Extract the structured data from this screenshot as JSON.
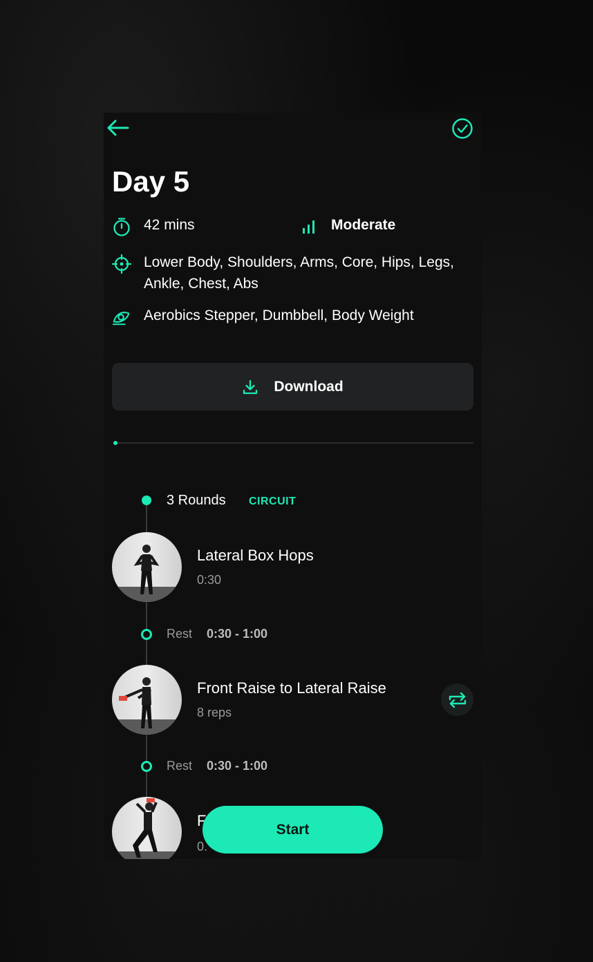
{
  "workout": {
    "title": "Day 5",
    "duration": "42 mins",
    "level": "Moderate",
    "target_areas": "Lower Body, Shoulders, Arms, Core, Hips, Legs, Ankle, Chest, Abs",
    "equipment": "Aerobics Stepper, Dumbbell, Body Weight"
  },
  "download_label": "Download",
  "circuit": {
    "rounds_label": "3 Rounds",
    "type_tag": "CIRCUIT"
  },
  "exercises": [
    {
      "name": "Lateral Box Hops",
      "detail": "0:30"
    },
    {
      "name": "Front Raise to Lateral Raise",
      "detail": "8 reps"
    },
    {
      "name": "F",
      "detail": "0."
    }
  ],
  "rests": [
    {
      "label": "Rest",
      "value": "0:30 - 1:00"
    },
    {
      "label": "Rest",
      "value": "0:30 - 1:00"
    }
  ],
  "start_label": "Start",
  "icons": {
    "back": "arrow-left-icon",
    "complete": "check-circle-icon",
    "duration": "stopwatch-icon",
    "level": "signal-bars-icon",
    "target": "crosshair-icon",
    "equipment": "equipment-icon",
    "download": "download-icon",
    "swap": "swap-icon"
  },
  "colors": {
    "accent": "#1de9b6",
    "background": "#0f0f0f",
    "card": "#202224"
  }
}
